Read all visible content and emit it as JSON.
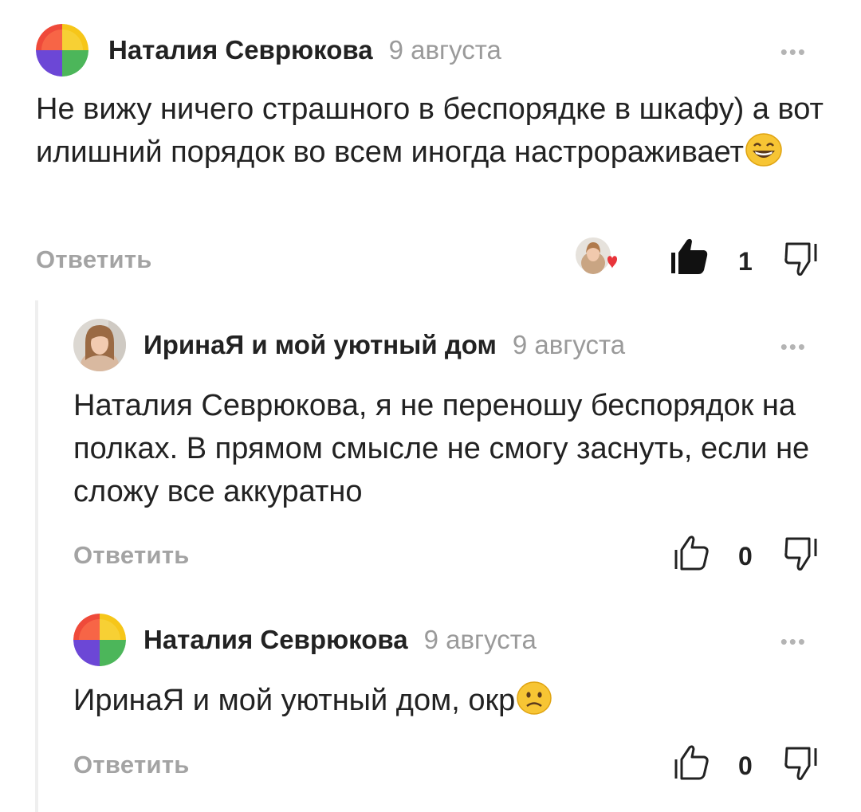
{
  "comments": [
    {
      "author": "Наталия Севрюкова",
      "date": "9 августа",
      "text": "Не вижу ничего страшного в беспорядке в шкафу) а вот илишний порядок во всем иногда настрораживает",
      "emoji": "grinning-face",
      "reply_label": "Ответить",
      "likes": "1",
      "liked": true,
      "avatar": "colorful-quadrant-avatar",
      "liker_avatar": "woman-photo-with-heart"
    },
    {
      "author": "ИринаЯ и мой уютный дом",
      "date": "9 августа",
      "text": "Наталия Севрюкова, я не переношу беспорядок на полках. В прямом смысле не смогу заснуть, если не сложу все аккуратно",
      "reply_label": "Ответить",
      "likes": "0",
      "liked": false,
      "avatar": "woman-photo-avatar"
    },
    {
      "author": "Наталия Севрюкова",
      "date": "9 августа",
      "text": "ИринаЯ и мой уютный дом, окр",
      "emoji": "slightly-frowning-face",
      "reply_label": "Ответить",
      "likes": "0",
      "liked": false,
      "avatar": "colorful-quadrant-avatar"
    }
  ],
  "menu_glyph": "•••",
  "colors": {
    "accent_red": "#e8343a",
    "quadrant_yellow": "#f6c619",
    "quadrant_red": "#ef4a3a",
    "quadrant_purple": "#6c47d6",
    "quadrant_green": "#4cb65a",
    "muted_text": "#a3a3a3"
  }
}
